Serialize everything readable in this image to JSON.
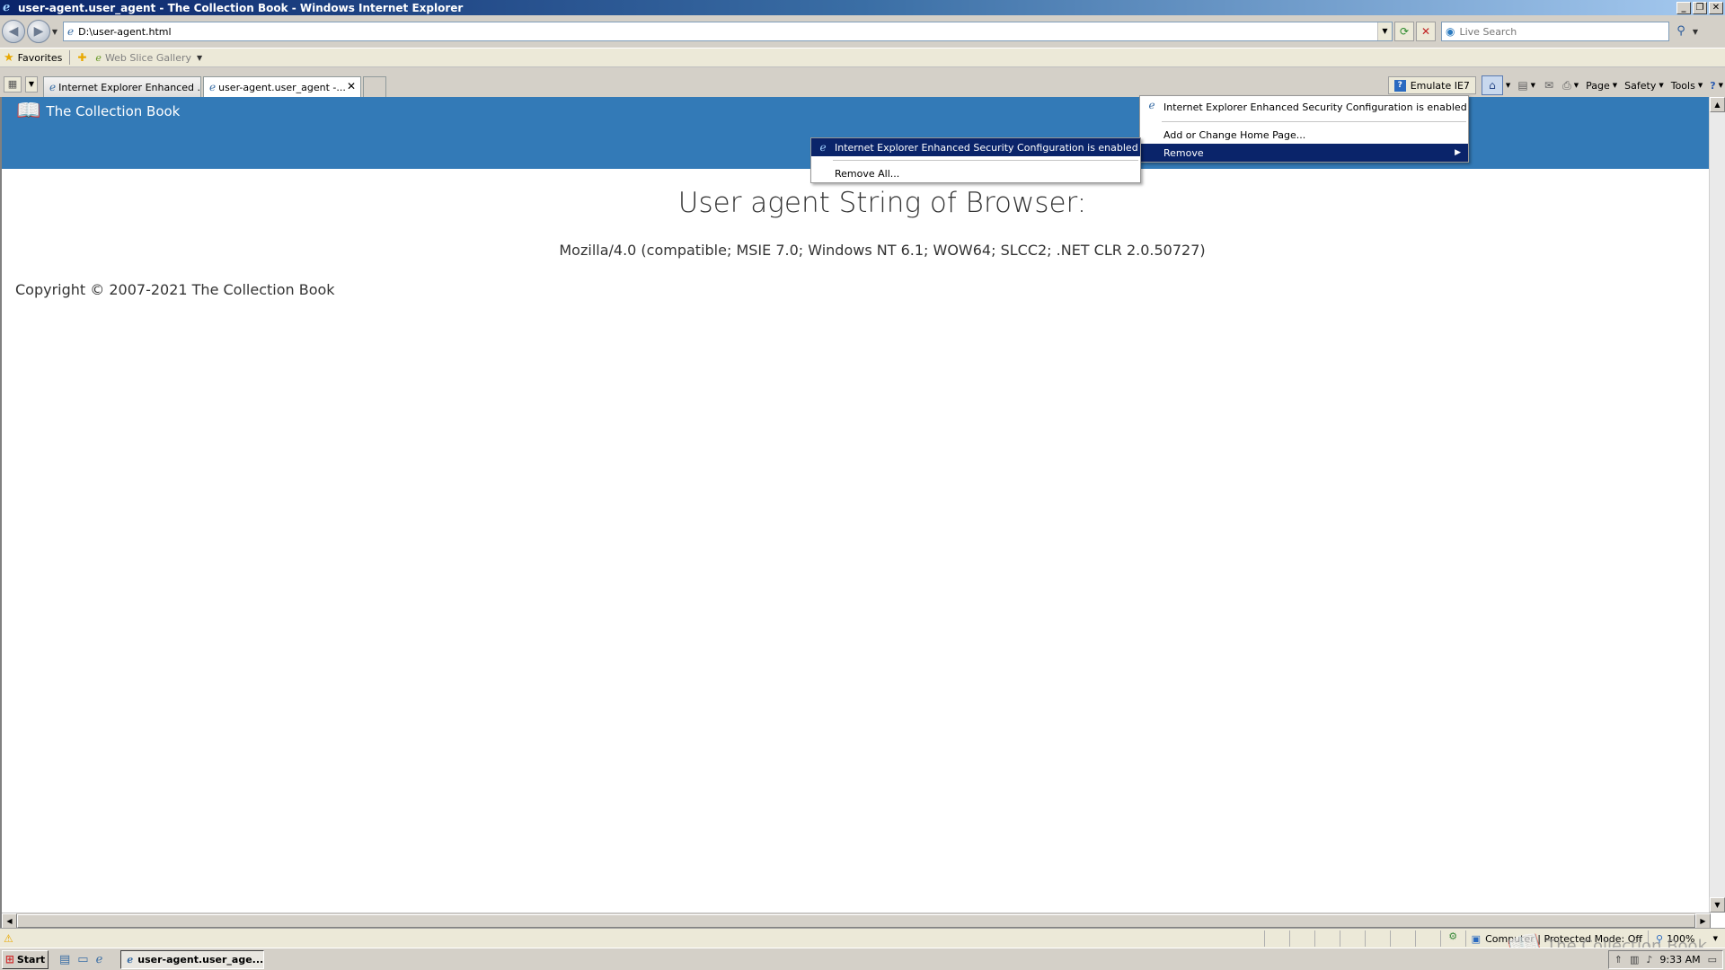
{
  "window": {
    "title": "user-agent.user_agent - The Collection Book - Windows Internet Explorer",
    "minimize": "_",
    "restore": "❐",
    "close": "✕"
  },
  "address": {
    "url": "D:\\user-agent.html",
    "search_placeholder": "Live Search"
  },
  "favorites": {
    "label": "Favorites",
    "web_slice": "Web Slice Gallery"
  },
  "tabs": [
    {
      "label": "Internet Explorer Enhanced ..."
    },
    {
      "label": "user-agent.user_agent -..."
    }
  ],
  "commandbar": {
    "emulate": "Emulate IE7",
    "page": "Page",
    "safety": "Safety",
    "tools": "Tools"
  },
  "page": {
    "brand": "The Collection Book",
    "title": "User agent String of Browser:",
    "user_agent": "Mozilla/4.0 (compatible; MSIE 7.0; Windows NT 6.1; WOW64; SLCC2; .NET CLR 2.0.50727)",
    "copyright": "Copyright © 2007-2021 The Collection Book"
  },
  "home_menu": {
    "items": [
      {
        "label": "Internet Explorer Enhanced Security Configuration is enabled"
      },
      {
        "label": "Add or Change Home Page..."
      },
      {
        "label": "Remove"
      }
    ]
  },
  "remove_submenu": {
    "items": [
      {
        "label": "Internet Explorer Enhanced Security Configuration is enabled"
      },
      {
        "label": "Remove All..."
      }
    ]
  },
  "statusbar": {
    "zone": "Computer | Protected Mode: Off",
    "zoom": "100%"
  },
  "taskbar": {
    "start": "Start",
    "task": "user-agent.user_age...",
    "time": "9:33 AM"
  },
  "watermark": "The Collection Book",
  "icons": {
    "ie": "ie-icon",
    "star": "star-icon",
    "home": "home-icon"
  }
}
